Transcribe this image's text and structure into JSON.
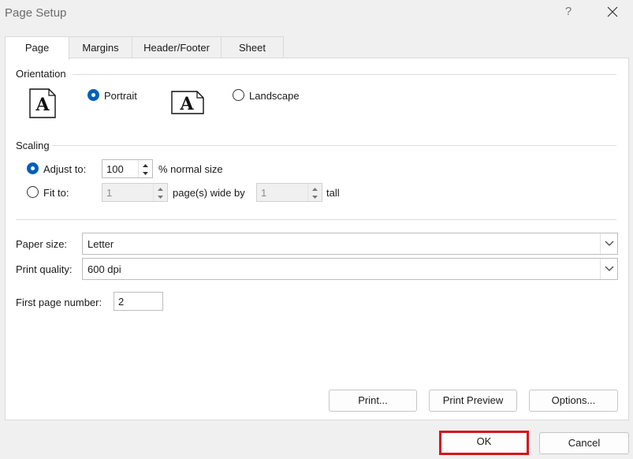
{
  "window": {
    "title": "Page Setup",
    "help": "?"
  },
  "tabs": [
    {
      "label": "Page",
      "active": true
    },
    {
      "label": "Margins",
      "active": false
    },
    {
      "label": "Header/Footer",
      "active": false
    },
    {
      "label": "Sheet",
      "active": false
    }
  ],
  "orientation": {
    "label": "Orientation",
    "portrait": {
      "label": "Portrait",
      "checked": true,
      "icon_glyph": "A"
    },
    "landscape": {
      "label": "Landscape",
      "checked": false,
      "icon_glyph": "A"
    }
  },
  "scaling": {
    "label": "Scaling",
    "adjust": {
      "label": "Adjust to:",
      "value": "100",
      "suffix": "% normal size",
      "checked": true
    },
    "fit": {
      "label": "Fit to:",
      "wide_value": "1",
      "wide_suffix": "page(s) wide by",
      "tall_value": "1",
      "tall_suffix": "tall",
      "checked": false
    }
  },
  "paper_size": {
    "label": "Paper size:",
    "value": "Letter"
  },
  "print_quality": {
    "label": "Print quality:",
    "value": "600 dpi"
  },
  "first_page_number": {
    "label": "First page number:",
    "value": "2"
  },
  "buttons": {
    "print": "Print...",
    "print_preview": "Print Preview",
    "options": "Options...",
    "ok": "OK",
    "cancel": "Cancel"
  },
  "colors": {
    "accent": "#005fb8",
    "highlight": "#d7141c",
    "background": "#f0f0f0"
  }
}
